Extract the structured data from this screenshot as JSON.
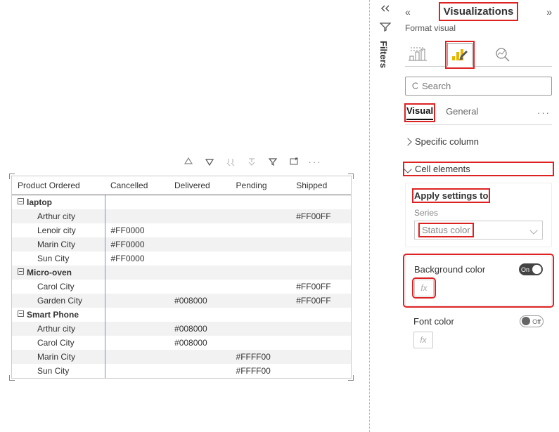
{
  "matrix": {
    "headers": [
      "Product Ordered",
      "Cancelled",
      "Delivered",
      "Pending",
      "Shipped"
    ],
    "groups": [
      {
        "name": "laptop",
        "rows": [
          {
            "city": "Arthur city",
            "cells": [
              "",
              "",
              "",
              "#FF00FF"
            ]
          },
          {
            "city": "Lenoir city",
            "cells": [
              "#FF0000",
              "",
              "",
              ""
            ]
          },
          {
            "city": "Marin City",
            "cells": [
              "#FF0000",
              "",
              "",
              ""
            ]
          },
          {
            "city": "Sun City",
            "cells": [
              "#FF0000",
              "",
              "",
              ""
            ]
          }
        ]
      },
      {
        "name": "Micro-oven",
        "rows": [
          {
            "city": "Carol City",
            "cells": [
              "",
              "",
              "",
              "#FF00FF"
            ]
          },
          {
            "city": "Garden City",
            "cells": [
              "",
              "#008000",
              "",
              "#FF00FF"
            ]
          }
        ]
      },
      {
        "name": "Smart Phone",
        "rows": [
          {
            "city": "Arthur city",
            "cells": [
              "",
              "#008000",
              "",
              ""
            ]
          },
          {
            "city": "Carol City",
            "cells": [
              "",
              "#008000",
              "",
              ""
            ]
          },
          {
            "city": "Marin City",
            "cells": [
              "",
              "",
              "#FFFF00",
              ""
            ]
          },
          {
            "city": "Sun City",
            "cells": [
              "",
              "",
              "#FFFF00",
              ""
            ]
          }
        ]
      }
    ]
  },
  "filters_label": "Filters",
  "panel": {
    "title": "Visualizations",
    "subtitle": "Format visual",
    "search_placeholder": "Search",
    "tab_visual": "Visual",
    "tab_general": "General",
    "sect_specific": "Specific column",
    "sect_cell": "Cell elements",
    "apply_title": "Apply settings to",
    "series_label": "Series",
    "series_value": "Status color",
    "bgcolor_label": "Background color",
    "bgcolor_toggle": "On",
    "fontcolor_label": "Font color",
    "fontcolor_toggle": "Off",
    "fx": "fx"
  }
}
